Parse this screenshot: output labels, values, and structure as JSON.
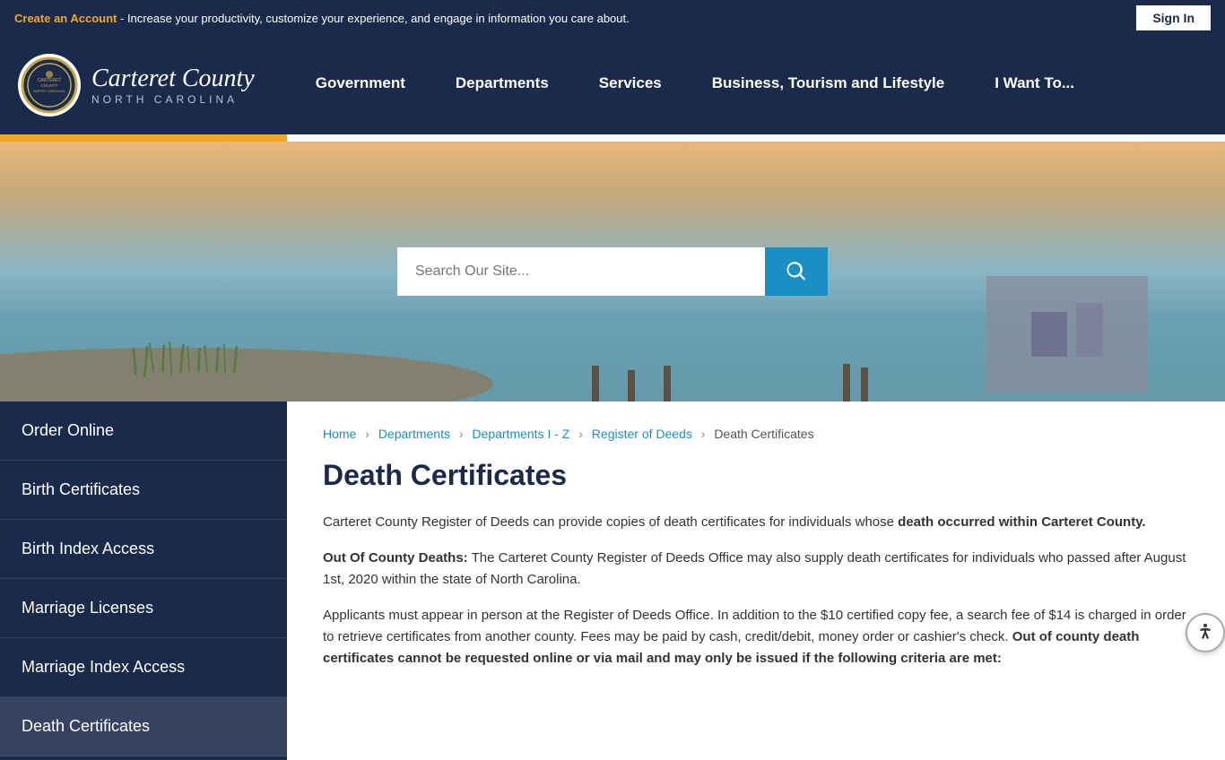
{
  "topbar": {
    "create_account_label": "Create an Account",
    "topbar_text": " - Increase your productivity, customize your experience, and engage in information you care about.",
    "sign_in_label": "Sign In"
  },
  "header": {
    "logo_county": "Carteret County",
    "logo_state": "North Carolina",
    "nav_items": [
      {
        "id": "government",
        "label": "Government"
      },
      {
        "id": "departments",
        "label": "Departments"
      },
      {
        "id": "services",
        "label": "Services"
      },
      {
        "id": "business",
        "label": "Business, Tourism and Lifestyle"
      },
      {
        "id": "i-want-to",
        "label": "I Want To..."
      }
    ]
  },
  "search": {
    "placeholder": "Search Our Site..."
  },
  "breadcrumb": {
    "items": [
      {
        "id": "home",
        "label": "Home",
        "href": "#"
      },
      {
        "id": "departments",
        "label": "Departments",
        "href": "#"
      },
      {
        "id": "departments-i-z",
        "label": "Departments I - Z",
        "href": "#"
      },
      {
        "id": "register-of-deeds",
        "label": "Register of Deeds",
        "href": "#"
      },
      {
        "id": "death-certificates",
        "label": "Death Certificates"
      }
    ]
  },
  "sidebar": {
    "items": [
      {
        "id": "order-online",
        "label": "Order Online",
        "active": false
      },
      {
        "id": "birth-certificates",
        "label": "Birth Certificates",
        "active": false
      },
      {
        "id": "birth-index-access",
        "label": "Birth Index Access",
        "active": false
      },
      {
        "id": "marriage-licenses",
        "label": "Marriage Licenses",
        "active": false
      },
      {
        "id": "marriage-index-access",
        "label": "Marriage Index Access",
        "active": false
      },
      {
        "id": "death-certificates",
        "label": "Death Certificates",
        "active": true
      }
    ]
  },
  "page": {
    "title": "Death Certificates",
    "paragraph1_normal": "Carteret County Register of Deeds can provide copies of death certificates for individuals whose ",
    "paragraph1_bold": "death occurred within Carteret County.",
    "paragraph2_label": "Out Of County Deaths:",
    "paragraph2_text": " The Carteret County Register of Deeds Office may also supply death certificates for individuals who passed after August 1st, 2020 within the state of North Carolina.",
    "paragraph3": "Applicants must appear in person at the Register of Deeds Office. In addition to the $10 certified copy fee, a search fee of $14 is charged in order to retrieve certificates from another county. Fees may be paid by cash, credit/debit, money order or cashier's check. ",
    "paragraph3_bold": "Out of county death certificates cannot be requested online or via mail and may only be issued if the following criteria are met:"
  },
  "colors": {
    "accent": "#f5a623",
    "primary_dark": "#1a2a4a",
    "primary_blue": "#1a8fc4"
  }
}
